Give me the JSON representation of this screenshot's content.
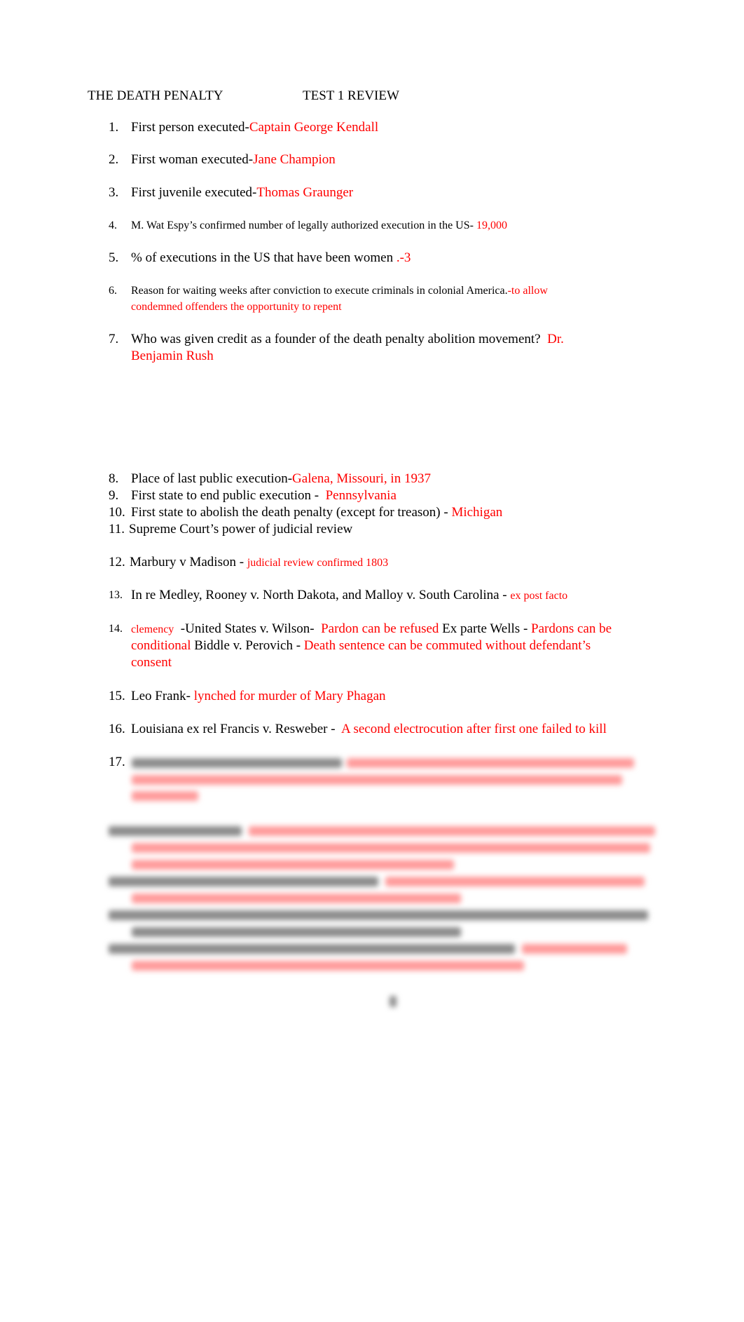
{
  "header": {
    "title_left": "THE DEATH PENALTY",
    "title_right": "TEST 1 REVIEW"
  },
  "items": [
    {
      "num": "1.",
      "q": "First person executed-",
      "a": "Captain George Kendall"
    },
    {
      "num": "2.",
      "q": "First woman executed-",
      "a": "Jane Champion"
    },
    {
      "num": "3.",
      "q": "First juvenile executed-",
      "a": "Thomas Graunger"
    },
    {
      "num": "4.",
      "q": "M. Wat Espy’s confirmed number of legally authorized execution in the US-",
      "a": " 19,000"
    },
    {
      "num": "5.",
      "q": "% of executions in the US that have been women ",
      "a": ".-3"
    },
    {
      "num": "6.",
      "q": "Reason for waiting weeks after conviction to execute criminals in colonial America.",
      "a": "-to allow",
      "a2": "condemned offenders the opportunity to repent"
    },
    {
      "num": "7.",
      "q": "Who was given credit as a founder of the death penalty abolition movement?  ",
      "a": "Dr.",
      "a2": "Benjamin Rush"
    },
    {
      "num": "8.",
      "q": "Place of last public execution-",
      "a": "Galena, Missouri, in 1937"
    },
    {
      "num": "9.",
      "q": "First state to end public execution -  ",
      "a": "Pennsylvania"
    },
    {
      "num": "10.",
      "q": "First state to abolish the death penalty (except for treason) - ",
      "a": "Michigan"
    },
    {
      "num": "11.",
      "q": "Supreme Court’s power of judicial review",
      "a": ""
    },
    {
      "num": "12.",
      "q": "Marbury v Madison - ",
      "a": "judicial review confirmed 1803"
    },
    {
      "num": "13.",
      "q": "In re Medley, Rooney v. North Dakota, and Malloy v. South Carolina - ",
      "a": "ex post facto"
    },
    {
      "num": "14.",
      "a": "clemency",
      "q": "  -United States v. Wilson-  ",
      "a_b": "Pardon can be refused",
      "q_b": " Ex parte Wells - ",
      "a_c": "Pardons can be",
      "a_c2": "conditional",
      "q_c": " Biddle v. Perovich - ",
      "a_d": "Death sentence can be commuted without defendant’s",
      "a_d2": "consent"
    },
    {
      "num": "15.",
      "q": "Leo Frank- ",
      "a": "lynched for murder of Mary Phagan"
    },
    {
      "num": "16.",
      "q": "Louisiana ex rel Francis v. Resweber -  ",
      "a": "A second electrocution after first one failed to kill"
    },
    {
      "num": "17."
    }
  ],
  "colors": {
    "answer": "#ff0000",
    "text": "#000000"
  }
}
